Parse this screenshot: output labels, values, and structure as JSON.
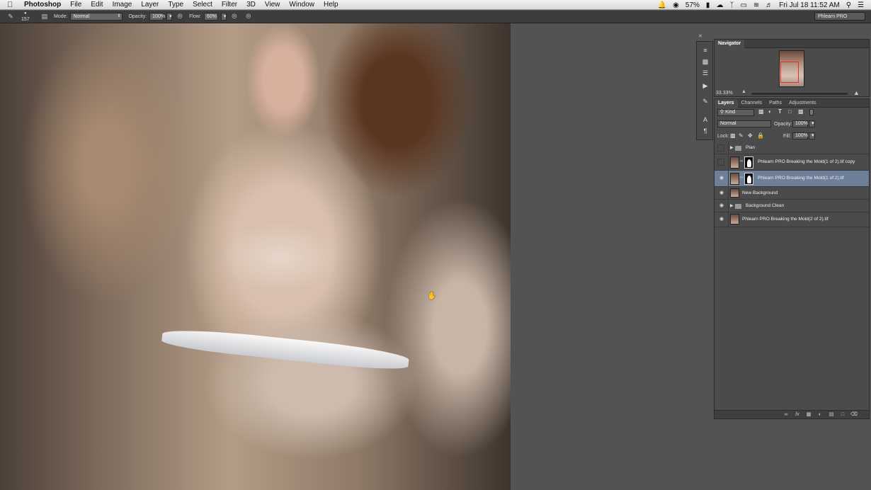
{
  "menubar": {
    "apple_glyph": "",
    "app_name": "Photoshop",
    "menus": [
      "File",
      "Edit",
      "Image",
      "Layer",
      "Type",
      "Select",
      "Filter",
      "3D",
      "View",
      "Window",
      "Help"
    ],
    "battery": "57%",
    "datetime": "Fri Jul 18  11:52 AM"
  },
  "options": {
    "brush_size": "157",
    "mode_label": "Mode:",
    "mode_value": "Normal",
    "opacity_label": "Opacity:",
    "opacity_value": "100%",
    "flow_label": "Flow:",
    "flow_value": "60%",
    "workspace": "Phlearn PRO"
  },
  "navigator": {
    "tab": "Navigator",
    "zoom": "33.33%"
  },
  "layers_panel": {
    "tabs": [
      "Layers",
      "Channels",
      "Paths",
      "Adjustments"
    ],
    "filter_kind": "Kind",
    "blend_mode": "Normal",
    "opacity_label": "Opacity:",
    "opacity_value": "100%",
    "lock_label": "Lock:",
    "fill_label": "Fill:",
    "fill_value": "100%",
    "layers": [
      {
        "name": "Plan",
        "type": "group",
        "visible": false
      },
      {
        "name": "Phlearn PRO Breaking the Mold(1 of 2).tif copy",
        "type": "masked",
        "visible": false
      },
      {
        "name": "Phlearn PRO Breaking the Mold(1 of 2).tif",
        "type": "masked",
        "visible": true,
        "selected": true
      },
      {
        "name": "New Background",
        "type": "pixel",
        "visible": true
      },
      {
        "name": "Background Clean",
        "type": "group",
        "visible": true
      },
      {
        "name": "Phlearn PRO Breaking the Mold(2 of 2).tif",
        "type": "pixel",
        "visible": true
      }
    ]
  },
  "colors": {
    "foreground": "#000000",
    "background": "#ffffff",
    "selection": "#6e7f9a"
  }
}
